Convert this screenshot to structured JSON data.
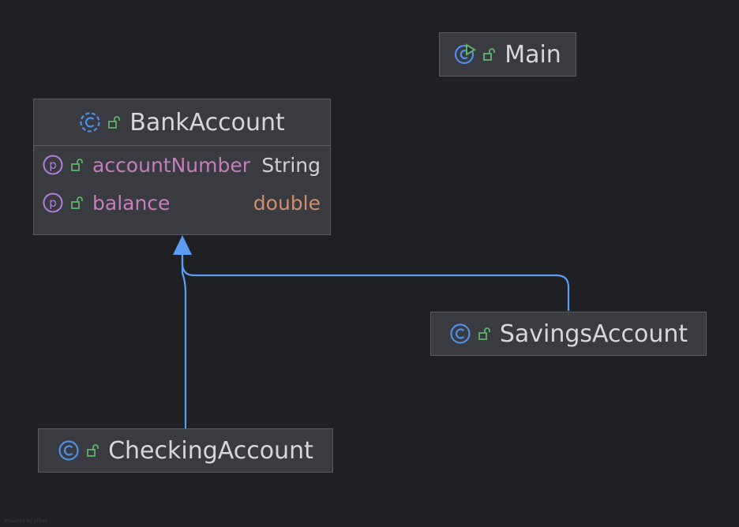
{
  "diagram": {
    "classes": [
      {
        "id": "main",
        "name": "Main",
        "icon": "runnable-class-icon",
        "visibility": "public-lock-icon"
      },
      {
        "id": "bank-account",
        "name": "BankAccount",
        "icon": "abstract-class-icon",
        "visibility": "public-lock-icon",
        "fields": [
          {
            "name": "accountNumber",
            "type": "String",
            "icon": "property-icon",
            "visibility": "public-lock-icon"
          },
          {
            "name": "balance",
            "type": "double",
            "icon": "property-icon",
            "visibility": "public-lock-icon"
          }
        ]
      },
      {
        "id": "savings-account",
        "name": "SavingsAccount",
        "icon": "class-icon",
        "visibility": "public-lock-icon"
      },
      {
        "id": "checking-account",
        "name": "CheckingAccount",
        "icon": "class-icon",
        "visibility": "public-lock-icon"
      }
    ],
    "relationships": [
      {
        "type": "inheritance",
        "from": "SavingsAccount",
        "to": "BankAccount"
      },
      {
        "type": "inheritance",
        "from": "CheckingAccount",
        "to": "BankAccount"
      }
    ],
    "colors": {
      "background": "#1f2023",
      "node_fill": "#393b40",
      "node_border": "#5a5d63",
      "edge": "#5c9cf5",
      "class_icon": "#4f8fe8",
      "property_icon": "#b07fd6",
      "lock_icon": "#5fb36a",
      "field_name": "#c77dbb",
      "type_double": "#cf8e6d",
      "text": "#d5d7db"
    }
  },
  "watermark": "Powered by yFiles"
}
